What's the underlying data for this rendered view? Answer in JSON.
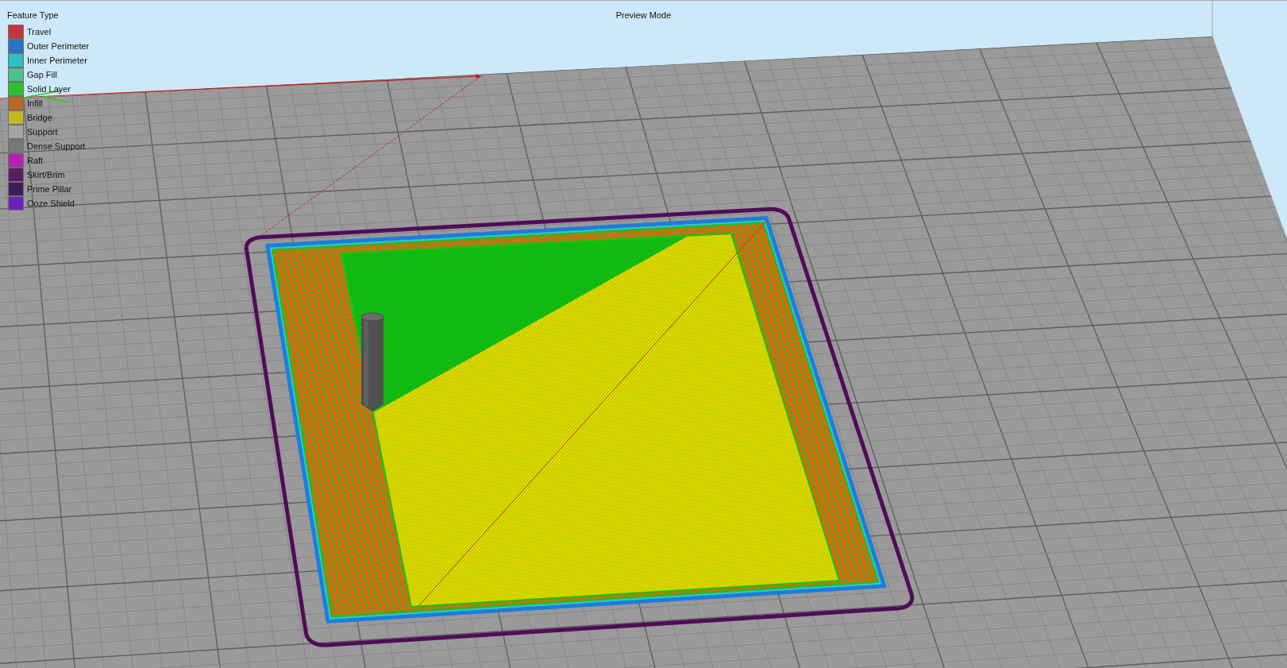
{
  "viewport": {
    "title": "Preview Mode"
  },
  "legend": {
    "title": "Feature Type",
    "items": [
      {
        "label": "Travel",
        "color": "#c0343c"
      },
      {
        "label": "Outer Perimeter",
        "color": "#2a72c4"
      },
      {
        "label": "Inner Perimeter",
        "color": "#2cbfc8"
      },
      {
        "label": "Gap Fill",
        "color": "#4cc08c"
      },
      {
        "label": "Solid Layer",
        "color": "#2fbf35"
      },
      {
        "label": "Infill",
        "color": "#b8692a"
      },
      {
        "label": "Bridge",
        "color": "#c2b822"
      },
      {
        "label": "Support",
        "color": "#a4a4a4"
      },
      {
        "label": "Dense Support",
        "color": "#787878"
      },
      {
        "label": "Raft",
        "color": "#b41fb4"
      },
      {
        "label": "Skirt/Brim",
        "color": "#5c1c5e"
      },
      {
        "label": "Prime Pillar",
        "color": "#3c1c5a"
      },
      {
        "label": "Ooze Shield",
        "color": "#6c22b8"
      }
    ]
  }
}
